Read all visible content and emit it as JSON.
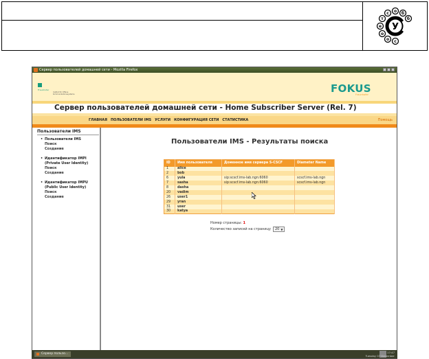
{
  "window": {
    "title": "Сервер пользователей домашней сети - Mozilla Firefox"
  },
  "banner": {
    "fraunhofer": "Fraunhofer",
    "fraunhofer_sub": "Institut für Offene Kommunikationssysteme",
    "fokus_logo": "FOKUS",
    "fokus_sub": "Fraunhofer"
  },
  "page_title": "Сервер пользователей домашней сети - Home Subscriber Server (Rel. 7)",
  "nav": {
    "items": [
      "ГЛАВНАЯ",
      "ПОЛЬЗОВАТЕЛИ IMS",
      "УСЛУГИ",
      "КОНФИГУРАЦИЯ СЕТИ",
      "СТАТИСТИКА"
    ],
    "help": "Помощь"
  },
  "sidebar": {
    "title": "Пользователи IMS",
    "groups": [
      {
        "head": "Пользователи IMS",
        "items": [
          "Поиск",
          "Создание"
        ]
      },
      {
        "head": "Идентификатор IMPI",
        "head2": "(Private User Identity)",
        "items": [
          "Поиск",
          "Создание"
        ]
      },
      {
        "head": "Идентификатор IMPU",
        "head2": "(Public User Identity)",
        "items": [
          "Поиск",
          "Создание"
        ]
      }
    ]
  },
  "main": {
    "title": "Пользователи IMS - Результаты поиска",
    "table": {
      "columns": [
        "ID",
        "Имя пользователя",
        "Доменное имя сервера S-CSCF",
        "Diameter Name"
      ],
      "rows": [
        [
          "1",
          "alice",
          "",
          ""
        ],
        [
          "2",
          "bob",
          "",
          ""
        ],
        [
          "6",
          "yula",
          "sip:scscf.ims-lab.ngn:6060",
          "scscf.ims-lab.ngn"
        ],
        [
          "7",
          "sasha",
          "sip:scscf.ims-lab.ngn:6060",
          "scscf.ims-lab.ngn"
        ],
        [
          "8",
          "dasha",
          "",
          ""
        ],
        [
          "20",
          "vadim",
          "",
          ""
        ],
        [
          "26",
          "user1",
          "",
          ""
        ],
        [
          "29",
          "yran",
          "",
          ""
        ],
        [
          "31",
          "user",
          "",
          ""
        ],
        [
          "30",
          "katya",
          "",
          ""
        ]
      ]
    },
    "pager_label": "Номер страницы:",
    "pager_value": "1",
    "perpage_label": "Количество записей на страницу",
    "perpage_value": "20"
  },
  "taskbar": {
    "task": "Сервер пользо...",
    "time": "17:47",
    "date": "Tuesday 07 December"
  }
}
